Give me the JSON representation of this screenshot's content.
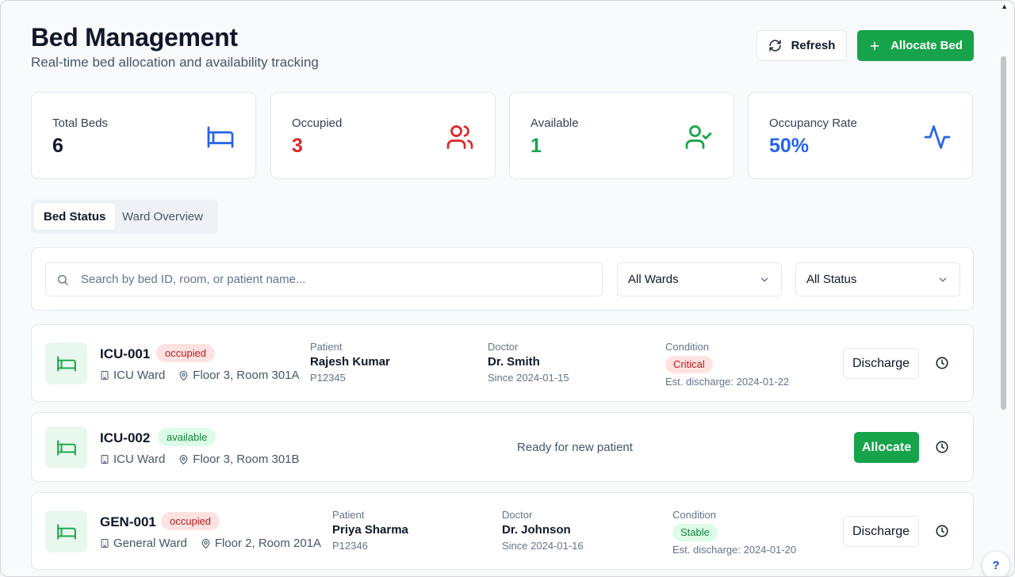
{
  "header": {
    "title": "Bed Management",
    "subtitle": "Real-time bed allocation and availability tracking",
    "refresh_label": "Refresh",
    "allocate_label": "Allocate Bed"
  },
  "stats": [
    {
      "label": "Total Beds",
      "value": "6",
      "color": "#0f172a",
      "icon": "bed-icon"
    },
    {
      "label": "Occupied",
      "value": "3",
      "color": "#dc2626",
      "icon": "users-icon"
    },
    {
      "label": "Available",
      "value": "1",
      "color": "#16a34a",
      "icon": "user-check-icon"
    },
    {
      "label": "Occupancy Rate",
      "value": "50%",
      "color": "#2563eb",
      "icon": "activity-icon"
    }
  ],
  "tabs": [
    {
      "label": "Bed Status",
      "active": true
    },
    {
      "label": "Ward Overview",
      "active": false
    }
  ],
  "filters": {
    "search_placeholder": "Search by bed ID, room, or patient name...",
    "ward_value": "All Wards",
    "status_value": "All Status"
  },
  "beds": [
    {
      "id": "ICU-001",
      "status": "occupied",
      "ward": "ICU Ward",
      "location": "Floor 3, Room 301A",
      "patient_label": "Patient",
      "patient_name": "Rajesh Kumar",
      "patient_id": "P12345",
      "doctor_label": "Doctor",
      "doctor_name": "Dr. Smith",
      "since": "Since 2024-01-15",
      "condition_label": "Condition",
      "condition": "Critical",
      "est_discharge": "Est. discharge: 2024-01-22",
      "action": "Discharge"
    },
    {
      "id": "ICU-002",
      "status": "available",
      "ward": "ICU Ward",
      "location": "Floor 3, Room 301B",
      "ready_text": "Ready for new patient",
      "action": "Allocate"
    },
    {
      "id": "GEN-001",
      "status": "occupied",
      "ward": "General Ward",
      "location": "Floor 2, Room 201A",
      "patient_label": "Patient",
      "patient_name": "Priya Sharma",
      "patient_id": "P12346",
      "doctor_label": "Doctor",
      "doctor_name": "Dr. Johnson",
      "since": "Since 2024-01-16",
      "condition_label": "Condition",
      "condition": "Stable",
      "est_discharge": "Est. discharge: 2024-01-20",
      "action": "Discharge"
    }
  ],
  "help": "?"
}
